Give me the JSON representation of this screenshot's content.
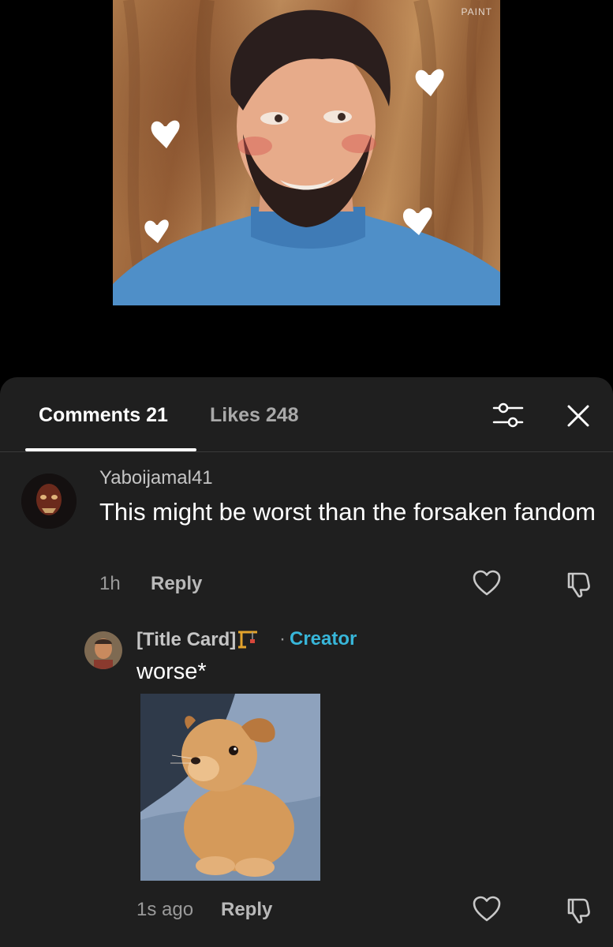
{
  "artwork": {
    "watermark": "PAINT"
  },
  "tabs": [
    {
      "label": "Comments 21"
    },
    {
      "label": "Likes 248"
    }
  ],
  "comments": [
    {
      "username": "Yaboijamal41",
      "text": "This might be worst than the forsaken fandom",
      "time": "1h",
      "reply_label": "Reply"
    },
    {
      "username": "[Title Card]",
      "badge_separator": "·",
      "badge": "Creator",
      "text": "worse*",
      "time": "1s ago",
      "reply_label": "Reply"
    }
  ],
  "colors": {
    "sheet_bg": "#1f1f1f",
    "creator_badge": "#38b6d9",
    "active_tab": "#ffffff",
    "inactive_tab": "#a9a9a9"
  },
  "icons": [
    "filter-icon",
    "close-icon",
    "heart-icon",
    "dislike-icon"
  ]
}
